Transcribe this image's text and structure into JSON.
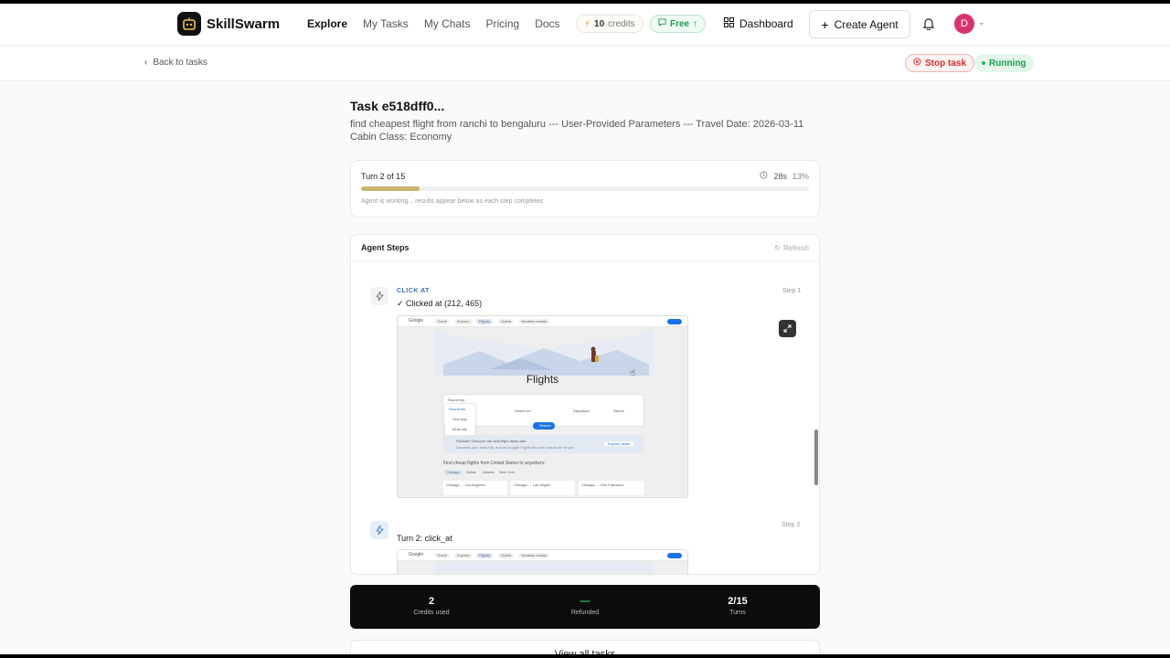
{
  "brand": {
    "name": "SkillSwarm",
    "icon": "robot-icon"
  },
  "nav": [
    {
      "label": "Explore",
      "active": true
    },
    {
      "label": "My Tasks",
      "active": false
    },
    {
      "label": "My Chats",
      "active": false
    },
    {
      "label": "Pricing",
      "active": false
    },
    {
      "label": "Docs",
      "active": false
    }
  ],
  "credits": {
    "value": "10",
    "label": "credits",
    "icon": "lightning-icon"
  },
  "plan": {
    "label": "Free",
    "icon": "arrow-up-icon"
  },
  "dashboard": {
    "label": "Dashboard",
    "icon": "grid-icon"
  },
  "create_agent": {
    "label": "Create Agent",
    "icon": "plus-icon"
  },
  "user": {
    "initial": "D",
    "avatar_color": "#d8346c"
  },
  "subbar": {
    "back_label": "Back to tasks",
    "stop_label": "Stop task",
    "status_label": "Running"
  },
  "task": {
    "title": "Task e518dff0...",
    "description": "find cheapest flight from ranchi to bengaluru --- User-Provided Parameters --- Travel Date: 2026-03-11 Cabin Class: Economy"
  },
  "progress": {
    "turn_label": "Turn 2 of 15",
    "elapsed": "28s",
    "percent_label": "13%",
    "fraction": 0.13,
    "note": "Agent is working... results appear below as each step completes"
  },
  "steps_panel": {
    "title": "Agent Steps",
    "refresh_label": "Refresh",
    "steps": [
      {
        "action": "CLICK AT",
        "text": "✓ Clicked at (212, 465)",
        "step_label": "Step 1",
        "screenshot": {
          "brand": "Google",
          "tabs": [
            "Travel",
            "Explore",
            "Flights",
            "Hotels",
            "Vacation rentals"
          ],
          "heading": "Flights",
          "trip_type": "Round trip",
          "trip_options": [
            "Round trip",
            "One way",
            "Multi-city"
          ],
          "where_to": "Where to?",
          "departure": "Departure",
          "return": "Return",
          "search": "Search",
          "info": "Flexible? Discover the best flight deals with",
          "info_sub": "Describe your ideal trip, and let Google Flights find the best deals for you",
          "explore_btn": "Explore deals",
          "cheap_heading": "Find cheap flights from United States to anywhere",
          "city_tabs": [
            "Chicago",
            "Dallas",
            "Atlanta",
            "New York"
          ],
          "routes": [
            "Chicago → Los Angeles",
            "Chicago → Las Vegas",
            "Chicago → San Francisco"
          ]
        }
      },
      {
        "action": "",
        "text": "Turn 2: click_at",
        "step_label": "Step 2",
        "screenshot": {
          "brand": "Google",
          "tabs": [
            "Travel",
            "Explore",
            "Flights",
            "Hotels",
            "Vacation rentals"
          ]
        }
      }
    ]
  },
  "stats": [
    {
      "value": "2",
      "label": "Credits used"
    },
    {
      "value": "—",
      "label": "Refunded"
    },
    {
      "value": "2/15",
      "label": "Turns"
    }
  ],
  "view_all_label": "View all tasks"
}
